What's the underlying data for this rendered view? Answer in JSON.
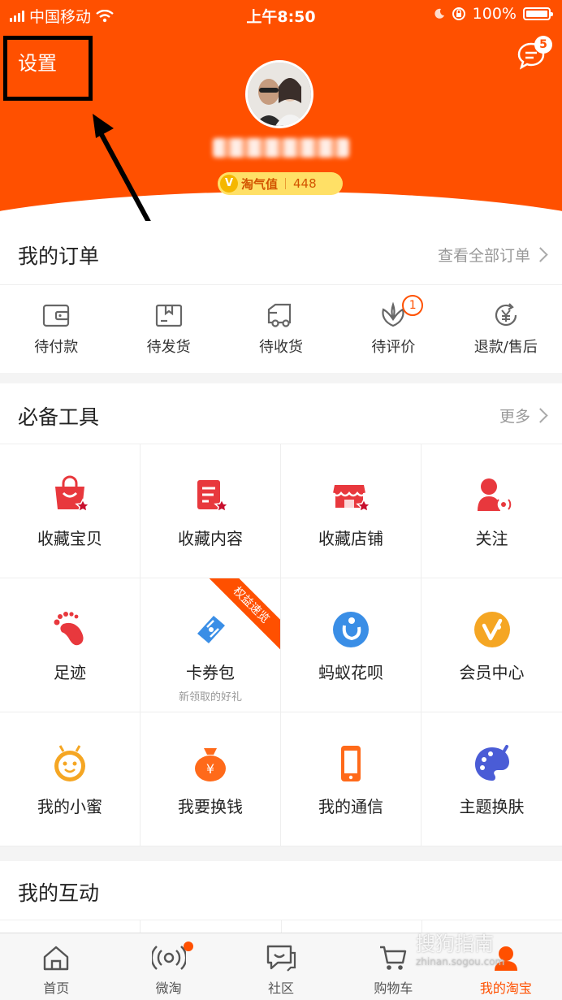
{
  "status_bar": {
    "carrier": "中国移动",
    "time": "上午8:50",
    "battery": "100%"
  },
  "header": {
    "settings_label": "设置",
    "message_badge": "5",
    "taoqi_label": "淘气值",
    "taoqi_value": "448",
    "brand_color": "#ff5000"
  },
  "orders": {
    "title": "我的订单",
    "view_all": "查看全部订单",
    "items": [
      {
        "label": "待付款",
        "icon": "wallet-icon"
      },
      {
        "label": "待发货",
        "icon": "box-icon"
      },
      {
        "label": "待收货",
        "icon": "truck-icon"
      },
      {
        "label": "待评价",
        "icon": "review-icon",
        "badge": "1"
      },
      {
        "label": "退款/售后",
        "icon": "refund-icon"
      }
    ]
  },
  "tools": {
    "title": "必备工具",
    "more": "更多",
    "items": [
      {
        "label": "收藏宝贝",
        "icon": "favorite-bag-icon"
      },
      {
        "label": "收藏内容",
        "icon": "favorite-content-icon"
      },
      {
        "label": "收藏店铺",
        "icon": "favorite-shop-icon"
      },
      {
        "label": "关注",
        "icon": "follow-icon"
      },
      {
        "label": "足迹",
        "icon": "footprint-icon"
      },
      {
        "label": "卡券包",
        "icon": "coupon-icon",
        "sub": "新领取的好礼",
        "ribbon": "权益速览"
      },
      {
        "label": "蚂蚁花呗",
        "icon": "huabei-icon"
      },
      {
        "label": "会员中心",
        "icon": "member-icon"
      },
      {
        "label": "我的小蜜",
        "icon": "assistant-icon"
      },
      {
        "label": "我要换钱",
        "icon": "money-bag-icon"
      },
      {
        "label": "我的通信",
        "icon": "phone-icon"
      },
      {
        "label": "主题换肤",
        "icon": "theme-icon"
      }
    ]
  },
  "interaction": {
    "title": "我的互动"
  },
  "tabbar": {
    "items": [
      {
        "label": "首页",
        "icon": "home-icon"
      },
      {
        "label": "微淘",
        "icon": "weitao-icon"
      },
      {
        "label": "社区",
        "icon": "community-icon"
      },
      {
        "label": "购物车",
        "icon": "cart-icon"
      },
      {
        "label": "我的淘宝",
        "icon": "my-taobao-icon"
      }
    ]
  },
  "watermark": {
    "text": "搜狗指南",
    "url": "zhinan.sogou.com"
  }
}
